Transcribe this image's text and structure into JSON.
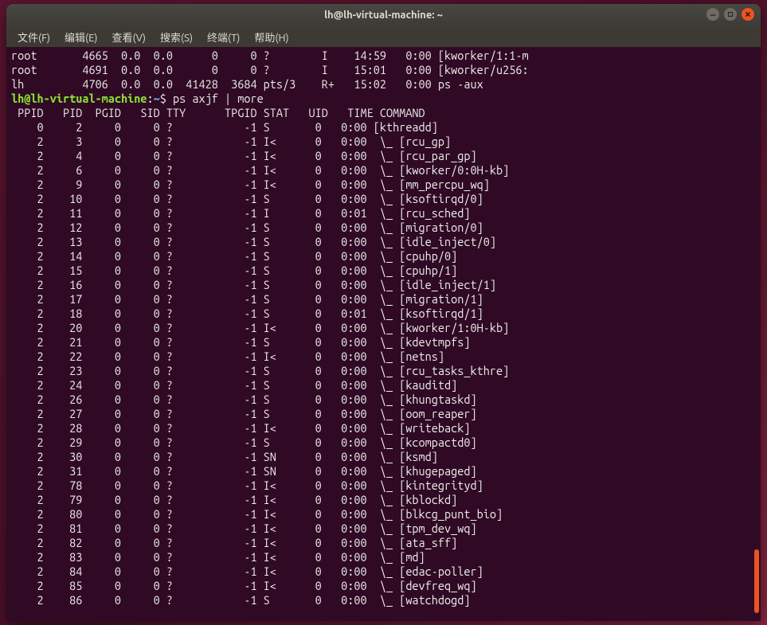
{
  "window": {
    "title": "lh@lh-virtual-machine: ~"
  },
  "menubar": {
    "items": [
      "文件(F)",
      "编辑(E)",
      "查看(V)",
      "搜索(S)",
      "终端(T)",
      "帮助(H)"
    ]
  },
  "pre_lines": [
    "root       4665  0.0  0.0      0     0 ?        I    14:59   0:00 [kworker/1:1-m",
    "root       4691  0.0  0.0      0     0 ?        I    15:01   0:00 [kworker/u256:",
    "lh         4706  0.0  0.0  41428  3684 pts/3    R+   15:02   0:00 ps -aux"
  ],
  "prompt": {
    "user_host": "lh@lh-virtual-machine",
    "colon": ":",
    "path": "~",
    "dollar": "$",
    "command": "ps axjf | more"
  },
  "header": " PPID   PID  PGID   SID TTY      TPGID STAT   UID   TIME COMMAND",
  "rows": [
    {
      "ppid": 0,
      "pid": 2,
      "pgid": 0,
      "sid": 0,
      "tty": "?",
      "tpgid": -1,
      "stat": "S",
      "uid": 0,
      "time": "0:00",
      "cmd": "[kthreadd]"
    },
    {
      "ppid": 2,
      "pid": 3,
      "pgid": 0,
      "sid": 0,
      "tty": "?",
      "tpgid": -1,
      "stat": "I<",
      "uid": 0,
      "time": "0:00",
      "cmd": " \\_ [rcu_gp]"
    },
    {
      "ppid": 2,
      "pid": 4,
      "pgid": 0,
      "sid": 0,
      "tty": "?",
      "tpgid": -1,
      "stat": "I<",
      "uid": 0,
      "time": "0:00",
      "cmd": " \\_ [rcu_par_gp]"
    },
    {
      "ppid": 2,
      "pid": 6,
      "pgid": 0,
      "sid": 0,
      "tty": "?",
      "tpgid": -1,
      "stat": "I<",
      "uid": 0,
      "time": "0:00",
      "cmd": " \\_ [kworker/0:0H-kb]"
    },
    {
      "ppid": 2,
      "pid": 9,
      "pgid": 0,
      "sid": 0,
      "tty": "?",
      "tpgid": -1,
      "stat": "I<",
      "uid": 0,
      "time": "0:00",
      "cmd": " \\_ [mm_percpu_wq]"
    },
    {
      "ppid": 2,
      "pid": 10,
      "pgid": 0,
      "sid": 0,
      "tty": "?",
      "tpgid": -1,
      "stat": "S",
      "uid": 0,
      "time": "0:00",
      "cmd": " \\_ [ksoftirqd/0]"
    },
    {
      "ppid": 2,
      "pid": 11,
      "pgid": 0,
      "sid": 0,
      "tty": "?",
      "tpgid": -1,
      "stat": "I",
      "uid": 0,
      "time": "0:01",
      "cmd": " \\_ [rcu_sched]"
    },
    {
      "ppid": 2,
      "pid": 12,
      "pgid": 0,
      "sid": 0,
      "tty": "?",
      "tpgid": -1,
      "stat": "S",
      "uid": 0,
      "time": "0:00",
      "cmd": " \\_ [migration/0]"
    },
    {
      "ppid": 2,
      "pid": 13,
      "pgid": 0,
      "sid": 0,
      "tty": "?",
      "tpgid": -1,
      "stat": "S",
      "uid": 0,
      "time": "0:00",
      "cmd": " \\_ [idle_inject/0]"
    },
    {
      "ppid": 2,
      "pid": 14,
      "pgid": 0,
      "sid": 0,
      "tty": "?",
      "tpgid": -1,
      "stat": "S",
      "uid": 0,
      "time": "0:00",
      "cmd": " \\_ [cpuhp/0]"
    },
    {
      "ppid": 2,
      "pid": 15,
      "pgid": 0,
      "sid": 0,
      "tty": "?",
      "tpgid": -1,
      "stat": "S",
      "uid": 0,
      "time": "0:00",
      "cmd": " \\_ [cpuhp/1]"
    },
    {
      "ppid": 2,
      "pid": 16,
      "pgid": 0,
      "sid": 0,
      "tty": "?",
      "tpgid": -1,
      "stat": "S",
      "uid": 0,
      "time": "0:00",
      "cmd": " \\_ [idle_inject/1]"
    },
    {
      "ppid": 2,
      "pid": 17,
      "pgid": 0,
      "sid": 0,
      "tty": "?",
      "tpgid": -1,
      "stat": "S",
      "uid": 0,
      "time": "0:00",
      "cmd": " \\_ [migration/1]"
    },
    {
      "ppid": 2,
      "pid": 18,
      "pgid": 0,
      "sid": 0,
      "tty": "?",
      "tpgid": -1,
      "stat": "S",
      "uid": 0,
      "time": "0:01",
      "cmd": " \\_ [ksoftirqd/1]"
    },
    {
      "ppid": 2,
      "pid": 20,
      "pgid": 0,
      "sid": 0,
      "tty": "?",
      "tpgid": -1,
      "stat": "I<",
      "uid": 0,
      "time": "0:00",
      "cmd": " \\_ [kworker/1:0H-kb]"
    },
    {
      "ppid": 2,
      "pid": 21,
      "pgid": 0,
      "sid": 0,
      "tty": "?",
      "tpgid": -1,
      "stat": "S",
      "uid": 0,
      "time": "0:00",
      "cmd": " \\_ [kdevtmpfs]"
    },
    {
      "ppid": 2,
      "pid": 22,
      "pgid": 0,
      "sid": 0,
      "tty": "?",
      "tpgid": -1,
      "stat": "I<",
      "uid": 0,
      "time": "0:00",
      "cmd": " \\_ [netns]"
    },
    {
      "ppid": 2,
      "pid": 23,
      "pgid": 0,
      "sid": 0,
      "tty": "?",
      "tpgid": -1,
      "stat": "S",
      "uid": 0,
      "time": "0:00",
      "cmd": " \\_ [rcu_tasks_kthre]"
    },
    {
      "ppid": 2,
      "pid": 24,
      "pgid": 0,
      "sid": 0,
      "tty": "?",
      "tpgid": -1,
      "stat": "S",
      "uid": 0,
      "time": "0:00",
      "cmd": " \\_ [kauditd]"
    },
    {
      "ppid": 2,
      "pid": 26,
      "pgid": 0,
      "sid": 0,
      "tty": "?",
      "tpgid": -1,
      "stat": "S",
      "uid": 0,
      "time": "0:00",
      "cmd": " \\_ [khungtaskd]"
    },
    {
      "ppid": 2,
      "pid": 27,
      "pgid": 0,
      "sid": 0,
      "tty": "?",
      "tpgid": -1,
      "stat": "S",
      "uid": 0,
      "time": "0:00",
      "cmd": " \\_ [oom_reaper]"
    },
    {
      "ppid": 2,
      "pid": 28,
      "pgid": 0,
      "sid": 0,
      "tty": "?",
      "tpgid": -1,
      "stat": "I<",
      "uid": 0,
      "time": "0:00",
      "cmd": " \\_ [writeback]"
    },
    {
      "ppid": 2,
      "pid": 29,
      "pgid": 0,
      "sid": 0,
      "tty": "?",
      "tpgid": -1,
      "stat": "S",
      "uid": 0,
      "time": "0:00",
      "cmd": " \\_ [kcompactd0]"
    },
    {
      "ppid": 2,
      "pid": 30,
      "pgid": 0,
      "sid": 0,
      "tty": "?",
      "tpgid": -1,
      "stat": "SN",
      "uid": 0,
      "time": "0:00",
      "cmd": " \\_ [ksmd]"
    },
    {
      "ppid": 2,
      "pid": 31,
      "pgid": 0,
      "sid": 0,
      "tty": "?",
      "tpgid": -1,
      "stat": "SN",
      "uid": 0,
      "time": "0:00",
      "cmd": " \\_ [khugepaged]"
    },
    {
      "ppid": 2,
      "pid": 78,
      "pgid": 0,
      "sid": 0,
      "tty": "?",
      "tpgid": -1,
      "stat": "I<",
      "uid": 0,
      "time": "0:00",
      "cmd": " \\_ [kintegrityd]"
    },
    {
      "ppid": 2,
      "pid": 79,
      "pgid": 0,
      "sid": 0,
      "tty": "?",
      "tpgid": -1,
      "stat": "I<",
      "uid": 0,
      "time": "0:00",
      "cmd": " \\_ [kblockd]"
    },
    {
      "ppid": 2,
      "pid": 80,
      "pgid": 0,
      "sid": 0,
      "tty": "?",
      "tpgid": -1,
      "stat": "I<",
      "uid": 0,
      "time": "0:00",
      "cmd": " \\_ [blkcg_punt_bio]"
    },
    {
      "ppid": 2,
      "pid": 81,
      "pgid": 0,
      "sid": 0,
      "tty": "?",
      "tpgid": -1,
      "stat": "I<",
      "uid": 0,
      "time": "0:00",
      "cmd": " \\_ [tpm_dev_wq]"
    },
    {
      "ppid": 2,
      "pid": 82,
      "pgid": 0,
      "sid": 0,
      "tty": "?",
      "tpgid": -1,
      "stat": "I<",
      "uid": 0,
      "time": "0:00",
      "cmd": " \\_ [ata_sff]"
    },
    {
      "ppid": 2,
      "pid": 83,
      "pgid": 0,
      "sid": 0,
      "tty": "?",
      "tpgid": -1,
      "stat": "I<",
      "uid": 0,
      "time": "0:00",
      "cmd": " \\_ [md]"
    },
    {
      "ppid": 2,
      "pid": 84,
      "pgid": 0,
      "sid": 0,
      "tty": "?",
      "tpgid": -1,
      "stat": "I<",
      "uid": 0,
      "time": "0:00",
      "cmd": " \\_ [edac-poller]"
    },
    {
      "ppid": 2,
      "pid": 85,
      "pgid": 0,
      "sid": 0,
      "tty": "?",
      "tpgid": -1,
      "stat": "I<",
      "uid": 0,
      "time": "0:00",
      "cmd": " \\_ [devfreq_wq]"
    },
    {
      "ppid": 2,
      "pid": 86,
      "pgid": 0,
      "sid": 0,
      "tty": "?",
      "tpgid": -1,
      "stat": "S",
      "uid": 0,
      "time": "0:00",
      "cmd": " \\_ [watchdogd]"
    }
  ]
}
